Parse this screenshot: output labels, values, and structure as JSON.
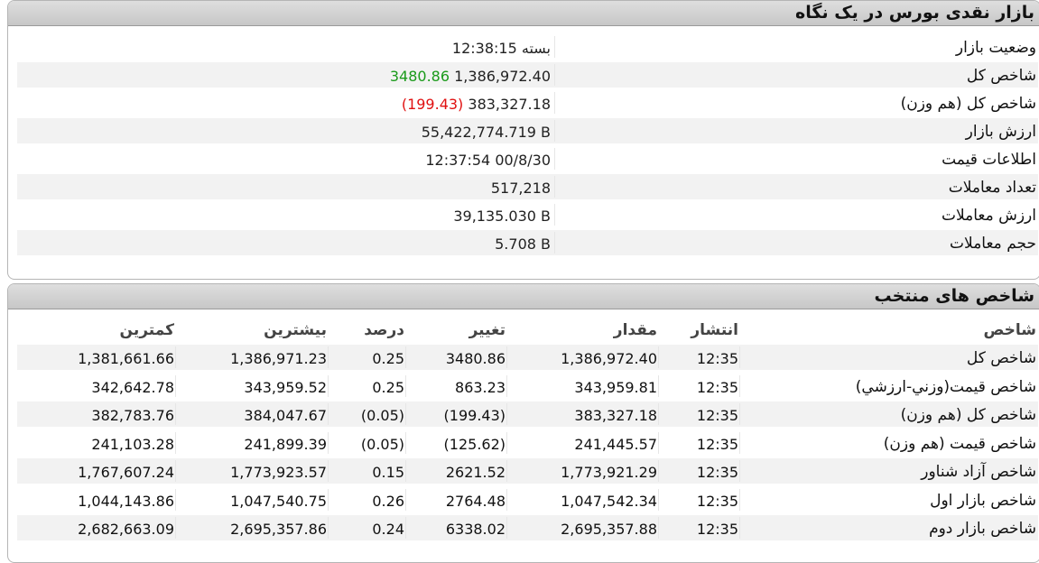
{
  "market_summary": {
    "title": "بازار نقدی بورس در یک نگاه",
    "rows": [
      {
        "label": "وضعیت بازار",
        "value": "بسته 12:38:15",
        "extra": "",
        "extra_color": ""
      },
      {
        "label": "شاخص کل",
        "value": "1,386,972.40",
        "extra": "3480.86",
        "extra_color": "green"
      },
      {
        "label": "شاخص کل (هم وزن)",
        "value": "383,327.18",
        "extra": "(199.43)",
        "extra_color": "red"
      },
      {
        "label": "ارزش بازار",
        "value": "55,422,774.719 B",
        "extra": "",
        "extra_color": ""
      },
      {
        "label": "اطلاعات قیمت",
        "value": "12:37:54 00/8/30",
        "extra": "",
        "extra_color": ""
      },
      {
        "label": "تعداد معاملات",
        "value": "517,218",
        "extra": "",
        "extra_color": ""
      },
      {
        "label": "ارزش معاملات",
        "value": "39,135.030 B",
        "extra": "",
        "extra_color": ""
      },
      {
        "label": "حجم معاملات",
        "value": "5.708 B",
        "extra": "",
        "extra_color": ""
      }
    ]
  },
  "selected_indices": {
    "title": "شاخص های منتخب",
    "headers": {
      "name": "شاخص",
      "time": "انتشار",
      "value": "مقدار",
      "change": "تغییر",
      "percent": "درصد",
      "max": "بیشترین",
      "min": "کمترین"
    },
    "rows": [
      {
        "name": "شاخص کل",
        "time": "12:35",
        "value": "1,386,972.40",
        "change": "3480.86",
        "percent": "0.25",
        "max": "1,386,971.23",
        "min": "1,381,661.66",
        "color": "green"
      },
      {
        "name": "شاخص قيمت(وزني-ارزشي)",
        "time": "12:35",
        "value": "343,959.81",
        "change": "863.23",
        "percent": "0.25",
        "max": "343,959.52",
        "min": "342,642.78",
        "color": "green"
      },
      {
        "name": "شاخص کل (هم وزن)",
        "time": "12:35",
        "value": "383,327.18",
        "change": "(199.43)",
        "percent": "(0.05)",
        "max": "384,047.67",
        "min": "382,783.76",
        "color": "red"
      },
      {
        "name": "شاخص قیمت (هم وزن)",
        "time": "12:35",
        "value": "241,445.57",
        "change": "(125.62)",
        "percent": "(0.05)",
        "max": "241,899.39",
        "min": "241,103.28",
        "color": "red"
      },
      {
        "name": "شاخص آزاد شناور",
        "time": "12:35",
        "value": "1,773,921.29",
        "change": "2621.52",
        "percent": "0.15",
        "max": "1,773,923.57",
        "min": "1,767,607.24",
        "color": "green"
      },
      {
        "name": "شاخص بازار اول",
        "time": "12:35",
        "value": "1,047,542.34",
        "change": "2764.48",
        "percent": "0.26",
        "max": "1,047,540.75",
        "min": "1,044,143.86",
        "color": "green"
      },
      {
        "name": "شاخص بازار دوم",
        "time": "12:35",
        "value": "2,695,357.88",
        "change": "6338.02",
        "percent": "0.24",
        "max": "2,695,357.86",
        "min": "2,682,663.09",
        "color": "green"
      }
    ]
  },
  "colors": {
    "positive": "#1a9a1a",
    "negative": "#e01010"
  }
}
